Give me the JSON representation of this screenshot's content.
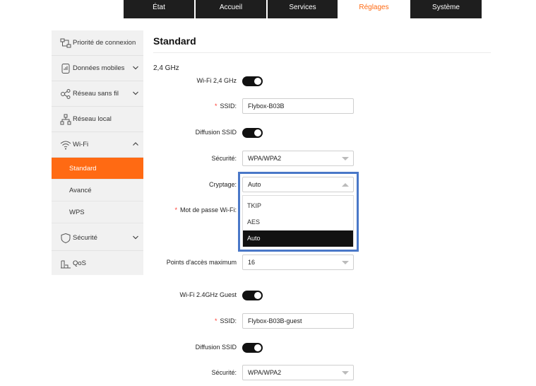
{
  "topnav": {
    "tabs": [
      {
        "label": "État"
      },
      {
        "label": "Accueil"
      },
      {
        "label": "Services"
      },
      {
        "label": "Réglages",
        "active": true
      },
      {
        "label": "Système"
      }
    ]
  },
  "sidebar": {
    "items": [
      {
        "label": "Priorité de connexion",
        "icon": "connection-priority-icon"
      },
      {
        "label": "Données mobiles",
        "icon": "mobile-data-icon"
      },
      {
        "label": "Réseau sans fil",
        "icon": "wireless-network-icon"
      },
      {
        "label": "Réseau local",
        "icon": "local-network-icon"
      },
      {
        "label": "Wi-Fi",
        "icon": "wifi-icon"
      },
      {
        "label": "Sécurité",
        "icon": "shield-icon"
      },
      {
        "label": "QoS",
        "icon": "qos-icon"
      }
    ],
    "wifi_sub": [
      {
        "label": "Standard",
        "active": true
      },
      {
        "label": "Avancé"
      },
      {
        "label": "WPS"
      }
    ]
  },
  "main": {
    "title": "Standard",
    "section": "2,4 GHz",
    "wifi24_label": "Wi-Fi 2,4 GHz",
    "ssid_label": "SSID:",
    "ssid_value": "Flybox-B03B",
    "broadcast_label": "Diffusion SSID",
    "security_label": "Sécurité:",
    "security_value": "WPA/WPA2",
    "encryption_label": "Cryptage:",
    "encryption_value": "Auto",
    "encryption_options": [
      "TKIP",
      "AES",
      "Auto"
    ],
    "password_label": "Mot de passe Wi-Fi:",
    "max_ap_label": "Points d'accès maximum",
    "max_ap_value": "16",
    "guest_label": "Wi-Fi 2.4GHz Guest",
    "guest_ssid_label": "SSID:",
    "guest_ssid_value": "Flybox-B03B-guest",
    "guest_broadcast_label": "Diffusion SSID",
    "guest_security_label": "Sécurité:",
    "guest_security_value": "WPA/WPA2"
  },
  "colors": {
    "accent": "#ff6a13",
    "highlight": "#4a78c8"
  }
}
